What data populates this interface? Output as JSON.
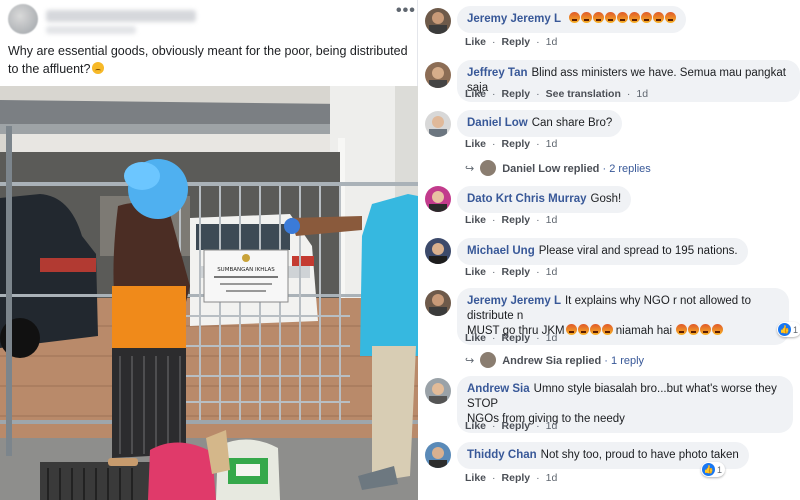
{
  "post": {
    "more_glyph": "•••",
    "text": "Why are essential goods, obviously meant for the poor, being distributed to the affluent?",
    "photo": {
      "sign_line1": "SUMBANGAN IKHLAS"
    }
  },
  "comments": [
    {
      "name": "Jeremy Jeremy L",
      "text": "",
      "angry_count": 9,
      "actions": [
        "Like",
        "Reply",
        "1d"
      ]
    },
    {
      "name": "Jeffrey Tan",
      "text": "Blind ass ministers we have. Semua mau pangkat saja",
      "actions": [
        "Like",
        "Reply",
        "See translation",
        "1d"
      ]
    },
    {
      "name": "Daniel Low",
      "text": "Can share Bro?",
      "actions": [
        "Like",
        "Reply",
        "1d"
      ],
      "replies": {
        "who": "Daniel Low replied",
        "count": "2 replies"
      }
    },
    {
      "name": "Dato Krt Chris Murray",
      "text": "Gosh!",
      "actions": [
        "Like",
        "Reply",
        "1d"
      ]
    },
    {
      "name": "Michael Ung",
      "text": "Please viral and spread to 195 nations.",
      "actions": [
        "Like",
        "Reply",
        "1d"
      ]
    },
    {
      "name": "Jeremy Jeremy L",
      "text_line1": "It explains why NGO r not allowed to distribute n",
      "text_line2a": "MUST go thru JKM",
      "text_line2b": "niamah hai",
      "actions": [
        "Like",
        "Reply",
        "1d"
      ],
      "likes": "1",
      "replies": {
        "who": "Andrew Sia replied",
        "count": "1 reply"
      }
    },
    {
      "name": "Andrew Sia",
      "text_line1": "Umno style biasalah bro...but what's worse they STOP",
      "text_line2": "NGOs from giving to the needy",
      "actions": [
        "Like",
        "Reply",
        "1d"
      ]
    },
    {
      "name": "Thiddy Chan",
      "text": "Not shy too, proud to have photo taken",
      "actions": [
        "Like",
        "Reply",
        "1d"
      ],
      "likes": "1"
    }
  ]
}
